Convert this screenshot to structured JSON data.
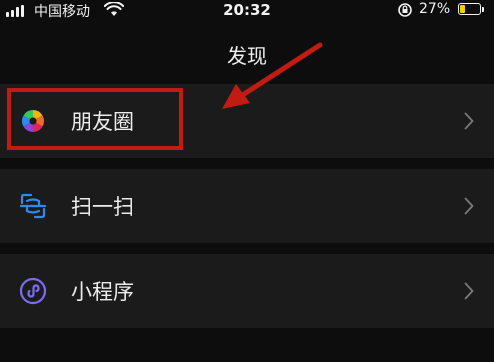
{
  "status_bar": {
    "carrier": "中国移动",
    "time": "20:32",
    "battery_percent": "27%",
    "battery_level": 0.27,
    "icons": [
      "signal-icon",
      "wifi-icon",
      "rotation-lock-icon",
      "battery-icon"
    ]
  },
  "nav": {
    "title": "发现"
  },
  "rows": [
    {
      "label": "朋友圈",
      "icon": "moments-icon"
    },
    {
      "label": "扫一扫",
      "icon": "scan-icon"
    },
    {
      "label": "小程序",
      "icon": "mini-program-icon"
    }
  ],
  "annotation": {
    "highlight_color": "#c11b14",
    "highlighted_item": "朋友圈"
  },
  "colors": {
    "background": "#0d0d0d",
    "row_background": "#1b1b1b",
    "scan_icon": "#2a8bf2",
    "mini_program_icon": "#7b6cf2",
    "battery_fill": "#f5d10a"
  }
}
